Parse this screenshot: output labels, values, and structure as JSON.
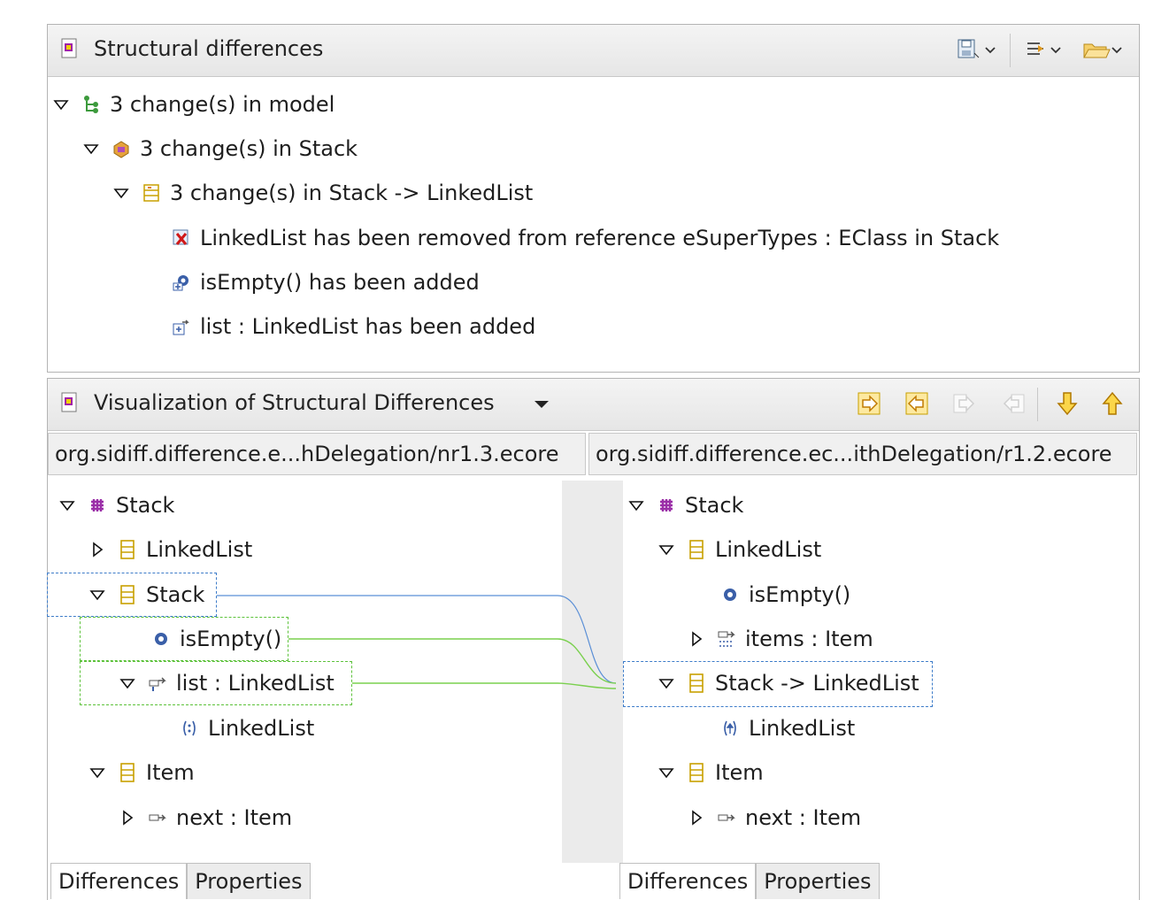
{
  "structural_view": {
    "title": "Structural differences",
    "toolbar": [
      "save-icon",
      "dropdown-icon",
      "filter-icon",
      "open-folder-icon"
    ],
    "tree": [
      {
        "label": "3 change(s) in model",
        "icon": "model-changes-icon",
        "expanded": true
      },
      {
        "label": "3 change(s) in Stack",
        "icon": "package-changes-icon",
        "expanded": true
      },
      {
        "label": "3 change(s) in Stack -> LinkedList",
        "icon": "class-changes-icon",
        "expanded": true
      },
      {
        "label": "LinkedList has been removed from reference eSuperTypes : EClass in Stack",
        "icon": "removed-reference-icon"
      },
      {
        "label": "isEmpty() has been added",
        "icon": "added-operation-icon"
      },
      {
        "label": "list : LinkedList has been added",
        "icon": "added-reference-icon"
      }
    ]
  },
  "visualization_view": {
    "title": "Visualization of Structural Differences",
    "toolbar": [
      "copy-left-to-right-icon",
      "copy-right-to-left-icon",
      "copy-all-right-icon",
      "copy-all-left-icon",
      "next-difference-icon",
      "previous-difference-icon"
    ],
    "left_path": "org.sidiff.difference.e...hDelegation/nr1.3.ecore",
    "right_path": "org.sidiff.difference.ec...ithDelegation/r1.2.ecore",
    "left_tree": [
      {
        "label": "Stack",
        "icon": "package-icon",
        "twisty": "expanded"
      },
      {
        "label": "LinkedList",
        "icon": "class-icon",
        "twisty": "collapsed"
      },
      {
        "label": "Stack",
        "icon": "class-icon",
        "twisty": "expanded"
      },
      {
        "label": "isEmpty()",
        "icon": "operation-icon",
        "twisty": "none"
      },
      {
        "label": "list : LinkedList",
        "icon": "reference-icon",
        "twisty": "expanded"
      },
      {
        "label": "LinkedList",
        "icon": "generic-type-icon",
        "twisty": "none"
      },
      {
        "label": "Item",
        "icon": "class-icon",
        "twisty": "expanded"
      },
      {
        "label": "next : Item",
        "icon": "reference-icon",
        "twisty": "collapsed"
      }
    ],
    "right_tree": [
      {
        "label": "Stack",
        "icon": "package-icon",
        "twisty": "expanded"
      },
      {
        "label": "LinkedList",
        "icon": "class-icon",
        "twisty": "expanded"
      },
      {
        "label": "isEmpty()",
        "icon": "operation-icon",
        "twisty": "none"
      },
      {
        "label": "items : Item",
        "icon": "containment-reference-icon",
        "twisty": "collapsed"
      },
      {
        "label": "Stack -> LinkedList",
        "icon": "class-icon",
        "twisty": "expanded"
      },
      {
        "label": "LinkedList",
        "icon": "supertype-icon",
        "twisty": "none"
      },
      {
        "label": "Item",
        "icon": "class-icon",
        "twisty": "expanded"
      },
      {
        "label": "next : Item",
        "icon": "reference-icon",
        "twisty": "collapsed"
      }
    ],
    "left_tabs": [
      "Differences",
      "Properties"
    ],
    "right_tabs": [
      "Differences",
      "Properties"
    ]
  },
  "colors": {
    "correspondence_line": "#5b8fd6",
    "added_line": "#7ad04e",
    "package": "#9b2fa8",
    "class": "#c8a000"
  }
}
